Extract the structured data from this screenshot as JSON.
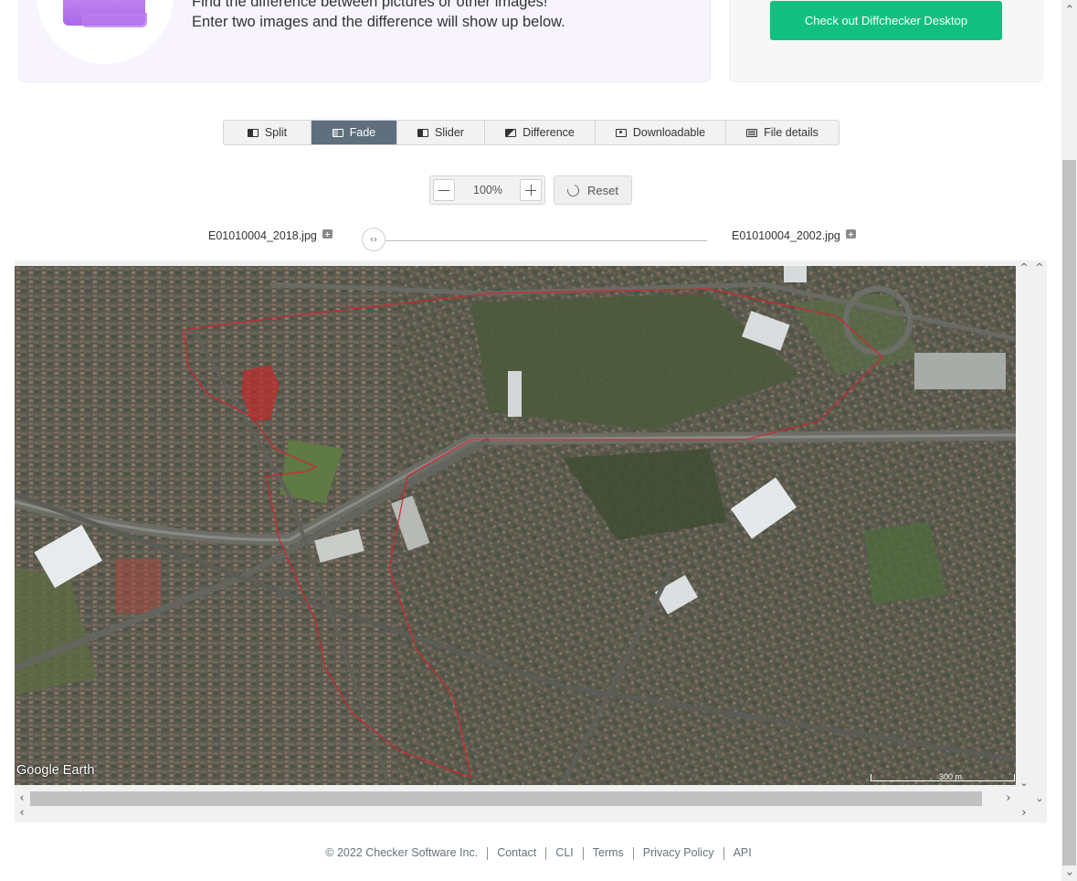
{
  "hero": {
    "line1": "Find the difference between pictures or other images!",
    "line2": "Enter two images and the difference will show up below."
  },
  "promo": {
    "button": "Check out Diffchecker Desktop",
    "accent": "#11c081"
  },
  "tabs": [
    {
      "label": "Split",
      "icon": "split-icon",
      "active": false
    },
    {
      "label": "Fade",
      "icon": "fade-icon",
      "active": true
    },
    {
      "label": "Slider",
      "icon": "slider-icon",
      "active": false
    },
    {
      "label": "Difference",
      "icon": "difference-icon",
      "active": false
    },
    {
      "label": "Downloadable",
      "icon": "download-icon",
      "active": false
    },
    {
      "label": "File details",
      "icon": "table-icon",
      "active": false
    }
  ],
  "zoom": {
    "value": "100%",
    "reset_label": "Reset"
  },
  "files": {
    "left": "E01010004_2018.jpg",
    "right": "E01010004_2002.jpg",
    "fade_position": 0
  },
  "image": {
    "watermark": "Google Earth",
    "scale": "300 m"
  },
  "footer": {
    "copyright": "© 2022 Checker Software Inc.",
    "links": [
      "Contact",
      "CLI",
      "Terms",
      "Privacy Policy",
      "API"
    ]
  },
  "colors": {
    "active_tab": "#5f6f7e",
    "boundary": "#d4232e"
  }
}
